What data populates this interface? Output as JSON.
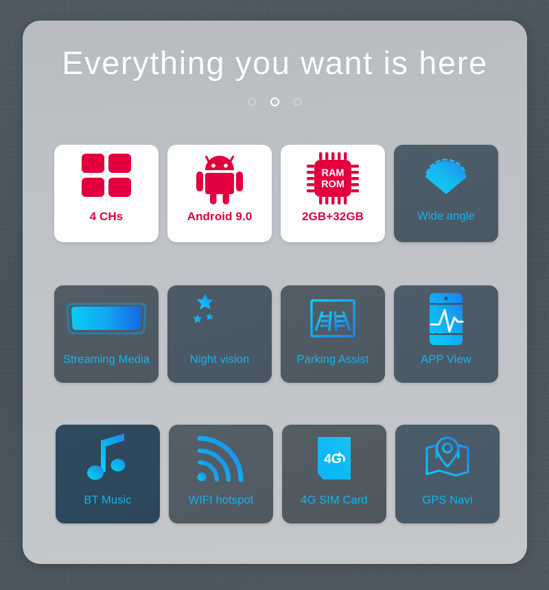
{
  "header": {
    "title": "Everything you want is here",
    "dots": {
      "count": 3,
      "active_index": 1
    }
  },
  "theme": {
    "page_background": "#4a545c",
    "panel_background": "#c0c3c7",
    "red_accent": "#e4003e",
    "cyan_accent": "#14b4ee",
    "dark_card": "#4b5a68",
    "light_card": "#fdfdfd",
    "title_color": "#ffffff"
  },
  "features": {
    "rows": [
      [
        {
          "label": "4 CHs",
          "icon": "four-squares-grid-icon",
          "style": "light",
          "label_color": "red"
        },
        {
          "label": "Android 9.0",
          "icon": "android-robot-icon",
          "style": "light",
          "label_color": "red"
        },
        {
          "label": "2GB+32GB",
          "icon": "ram-rom-chip-icon",
          "style": "light",
          "label_color": "red",
          "icon_text": {
            "line1": "RAM",
            "line2": "ROM"
          }
        },
        {
          "label": "Wide angle",
          "icon": "wide-angle-fan-icon",
          "style": "dark-a",
          "label_color": "cyan"
        }
      ],
      [
        {
          "label": "Streaming Media",
          "icon": "rearview-mirror-icon",
          "style": "dark-b",
          "label_color": "cyan"
        },
        {
          "label": "Night vision",
          "icon": "moon-stars-icon",
          "style": "dark-c",
          "label_color": "cyan"
        },
        {
          "label": "Parking Assist",
          "icon": "parking-guideline-screen-icon",
          "style": "dark-d",
          "label_color": "cyan"
        },
        {
          "label": "APP View",
          "icon": "phone-waveform-icon",
          "style": "dark-a",
          "label_color": "cyan"
        }
      ],
      [
        {
          "label": "BT Music",
          "icon": "music-note-icon",
          "style": "dark-e",
          "label_color": "cyan"
        },
        {
          "label": "WIFI hotspot",
          "icon": "wifi-signal-icon",
          "style": "dark-f",
          "label_color": "cyan"
        },
        {
          "label": "4G SIM Card",
          "icon": "sim-card-4g-icon",
          "style": "dark-g",
          "label_color": "cyan",
          "icon_text": {
            "line1": "4G"
          }
        },
        {
          "label": "GPS Navi",
          "icon": "map-pin-icon",
          "style": "dark-h",
          "label_color": "cyan"
        }
      ]
    ]
  }
}
